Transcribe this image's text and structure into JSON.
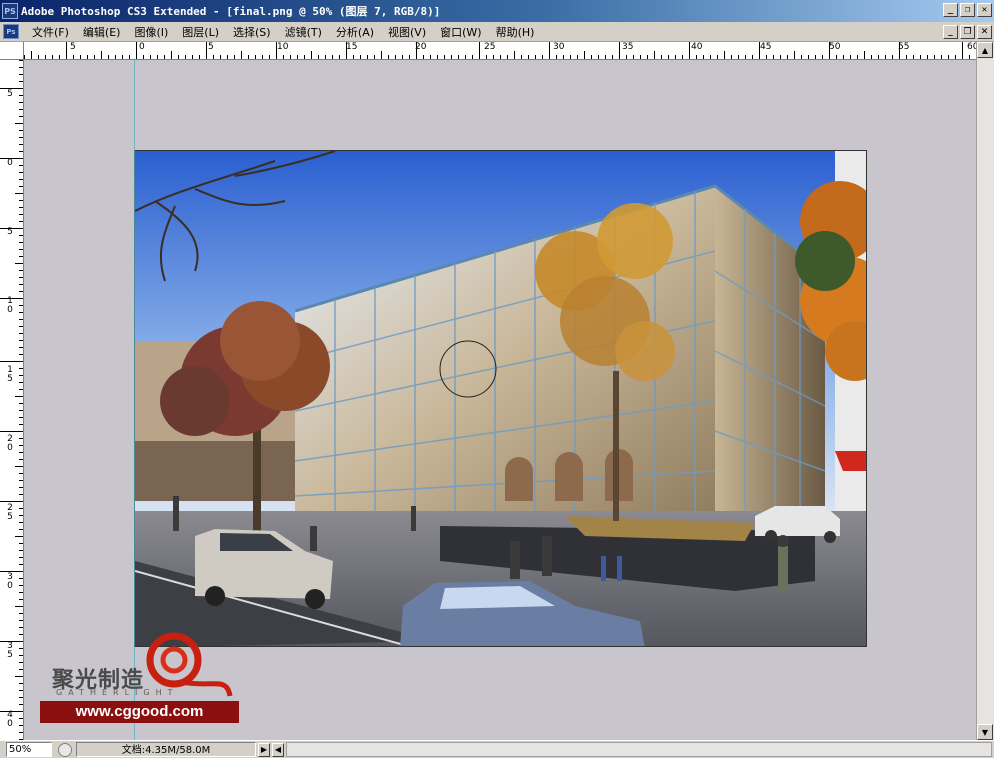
{
  "window": {
    "app_icon": "PS",
    "title": "Adobe Photoshop CS3 Extended - [final.png @ 50% (图层 7, RGB/8)]",
    "buttons": [
      "_",
      "❐",
      "✕"
    ]
  },
  "menu": {
    "doc_icon": "Ps",
    "items": [
      "文件(F)",
      "编辑(E)",
      "图像(I)",
      "图层(L)",
      "选择(S)",
      "滤镜(T)",
      "分析(A)",
      "视图(V)",
      "窗口(W)",
      "帮助(H)"
    ],
    "buttons": [
      "_",
      "❐",
      "✕"
    ]
  },
  "rulers": {
    "top_labels": [
      "5",
      "0",
      "5",
      "10",
      "15",
      "20",
      "25",
      "30",
      "35",
      "40",
      "45",
      "50",
      "55",
      "60"
    ],
    "left_labels": [
      "5",
      "0",
      "5",
      "10",
      "15",
      "20",
      "25",
      "30",
      "35",
      "40"
    ]
  },
  "statusbar": {
    "zoom": "50%",
    "doc_info": "文档:4.35M/58.0M"
  },
  "watermark": {
    "chinese": "聚光制造",
    "english": "GATHERLIGHT",
    "url": "www.cggood.com"
  },
  "icons": {
    "scroll_up": "▲",
    "scroll_down": "▼",
    "status_next": "▶",
    "status_prev": "◀"
  },
  "colors": {
    "titlebar_start": "#0a246a",
    "titlebar_end": "#a6caf0",
    "canvas_bg": "#c8c5cc",
    "logo_red": "#8a1010"
  }
}
